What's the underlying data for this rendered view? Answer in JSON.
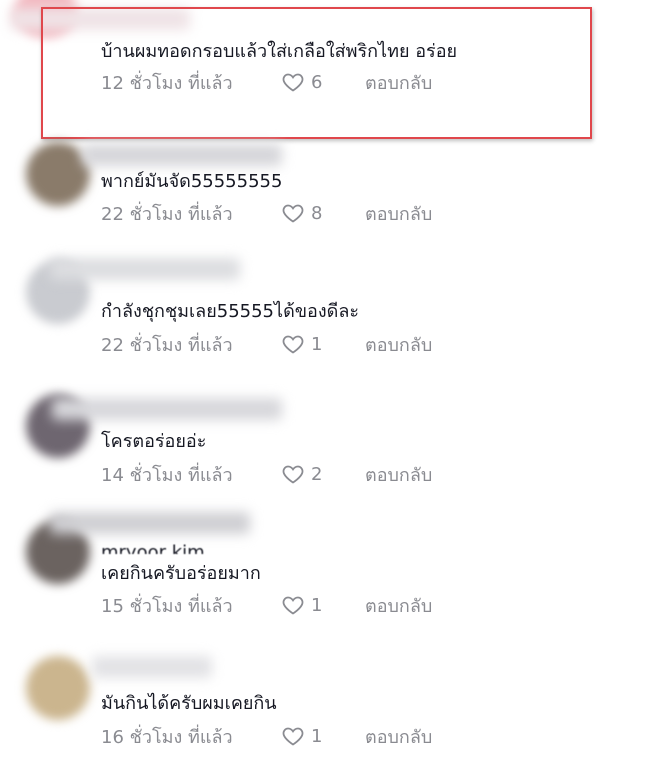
{
  "comments": [
    {
      "text": "บ้านผมทอดกรอบแล้วใส่เกลือใส่พริกไทย อร่อย",
      "time": "12 ชั่วโมง ที่แล้ว",
      "likes": "6",
      "reply": "ตอบกลับ"
    },
    {
      "text": "พากย์มันจัด55555555",
      "time": "22 ชั่วโมง ที่แล้ว",
      "likes": "8",
      "reply": "ตอบกลับ"
    },
    {
      "text": "กำลังชุกชุมเลย55555ได้ของดีละ",
      "time": "22 ชั่วโมง ที่แล้ว",
      "likes": "1",
      "reply": "ตอบกลับ"
    },
    {
      "text": "โครตอร่อยอ่ะ",
      "time": "14 ชั่วโมง ที่แล้ว",
      "likes": "2",
      "reply": "ตอบกลับ"
    },
    {
      "text": "เคยกินครับอร่อยมาก",
      "time": "15 ชั่วโมง ที่แล้ว",
      "likes": "1",
      "reply": "ตอบกลับ",
      "partial_username": "mryoor kim"
    },
    {
      "text": "มันกินได้ครับผมเคยกิน",
      "time": "16 ชั่วโมง ที่แล้ว",
      "likes": "1",
      "reply": "ตอบกลับ"
    }
  ],
  "colors": {
    "highlight_border": "#e0474c",
    "meta_text": "#8a8b91",
    "body_text": "#161823"
  },
  "icons": {
    "like": "heart-outline-icon"
  }
}
